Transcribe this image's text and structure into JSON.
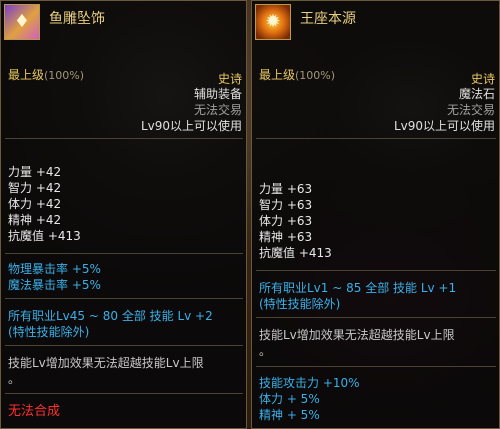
{
  "left": {
    "icon": "gem-icon",
    "title": "鱼雕坠饰",
    "grade": "最上级",
    "grade_pct": "(100%)",
    "rarity": "史诗",
    "type": "辅助装备",
    "trade": "无法交易",
    "level_req": "Lv90以上可以使用",
    "stats": [
      {
        "label": "力量",
        "value": "+42"
      },
      {
        "label": "智力",
        "value": "+42"
      },
      {
        "label": "体力",
        "value": "+42"
      },
      {
        "label": "精神",
        "value": "+42"
      },
      {
        "label": "抗魔值",
        "value": "+413"
      }
    ],
    "crit": [
      "物理暴击率 +5%",
      "魔法暴击率 +5%"
    ],
    "skill_line1": "所有职业Lv45 ~ 80 全部 技能 Lv +2",
    "skill_line2": "(特性技能除外)",
    "note_line1": "技能Lv增加效果无法超越技能Lv上限",
    "note_line2": "。",
    "noncraft": "无法合成"
  },
  "right": {
    "icon": "sun-icon",
    "title": "王座本源",
    "grade": "最上级",
    "grade_pct": "(100%)",
    "rarity": "史诗",
    "type": "魔法石",
    "trade": "无法交易",
    "level_req": "Lv90以上可以使用",
    "stats": [
      {
        "label": "力量",
        "value": "+63"
      },
      {
        "label": "智力",
        "value": "+63"
      },
      {
        "label": "体力",
        "value": "+63"
      },
      {
        "label": "精神",
        "value": "+63"
      },
      {
        "label": "抗魔值",
        "value": "+413"
      }
    ],
    "skill_line1": "所有职业Lv1 ~ 85 全部 技能 Lv +1",
    "skill_line2": "(特性技能除外)",
    "note_line1": "技能Lv增加效果无法超越技能Lv上限",
    "note_line2": "。",
    "bonus": [
      "技能攻击力 +10%",
      "体力 + 5%",
      "精神 + 5%"
    ]
  },
  "colors": {
    "rarity": "#e8c860",
    "skill": "#3ab0e8",
    "noncraft": "#ff3030"
  }
}
